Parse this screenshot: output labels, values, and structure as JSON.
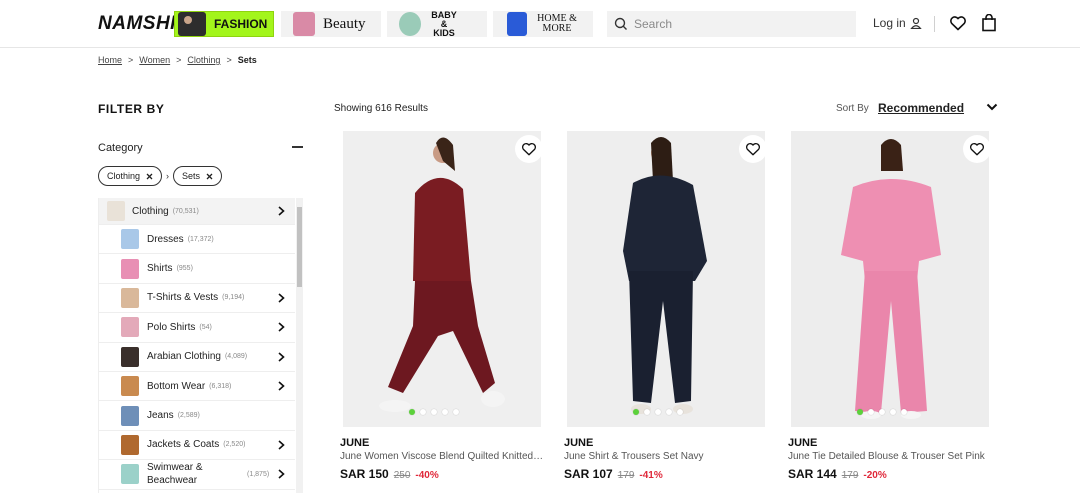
{
  "header": {
    "logo": "NAMSHI",
    "tabs": [
      {
        "label": "FASHION",
        "icon": "fashion-thumb"
      },
      {
        "label": "Beauty",
        "icon": "beauty-thumb"
      },
      {
        "label": "BABY & KIDS",
        "icon": "kids-thumb"
      },
      {
        "label": "HOME & MORE",
        "icon": "home-thumb"
      }
    ],
    "search_placeholder": "Search",
    "login_label": "Log in",
    "accent": "#a3f51b"
  },
  "breadcrumb": [
    "Home",
    "Women",
    "Clothing",
    "Sets"
  ],
  "filter": {
    "title": "FILTER BY",
    "category_heading": "Category",
    "chips": [
      "Clothing",
      "Sets"
    ],
    "categories": [
      {
        "label": "Clothing",
        "count": "(70,531)",
        "has_children": true,
        "parent": true
      },
      {
        "label": "Dresses",
        "count": "(17,372)",
        "has_children": false
      },
      {
        "label": "Shirts",
        "count": "(955)",
        "has_children": false
      },
      {
        "label": "T-Shirts & Vests",
        "count": "(9,194)",
        "has_children": true
      },
      {
        "label": "Polo Shirts",
        "count": "(54)",
        "has_children": true
      },
      {
        "label": "Arabian Clothing",
        "count": "(4,089)",
        "has_children": true
      },
      {
        "label": "Bottom Wear",
        "count": "(6,318)",
        "has_children": true
      },
      {
        "label": "Jeans",
        "count": "(2,589)",
        "has_children": false
      },
      {
        "label": "Jackets & Coats",
        "count": "(2,520)",
        "has_children": true
      },
      {
        "label": "Swimwear & Beachwear",
        "count": "(1,875)",
        "has_children": true
      }
    ]
  },
  "results": {
    "count_text": "Showing 616 Results",
    "sort_label": "Sort By",
    "sort_value": "Recommended"
  },
  "products": [
    {
      "brand": "JUNE",
      "name": "June Women Viscose Blend Quilted Knitted Jogger Set",
      "price": "SAR 150",
      "was": "250",
      "discount": "-40%",
      "garment_color": "#7a1c22"
    },
    {
      "brand": "JUNE",
      "name": "June Shirt & Trousers Set Navy",
      "price": "SAR 107",
      "was": "179",
      "discount": "-41%",
      "garment_color": "#1e2536"
    },
    {
      "brand": "JUNE",
      "name": "June Tie Detailed Blouse & Trouser Set Pink",
      "price": "SAR 144",
      "was": "179",
      "discount": "-20%",
      "garment_color": "#ee8fb2"
    }
  ]
}
